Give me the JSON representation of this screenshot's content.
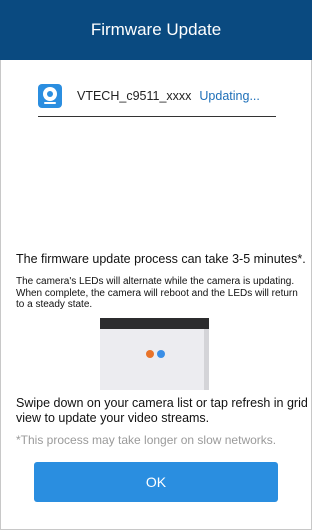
{
  "header": {
    "title": "Firmware Update"
  },
  "device": {
    "icon": "camera-icon",
    "name": "VTECH_c9511_xxxx",
    "status": "Updating..."
  },
  "info": {
    "main": "The firmware update process can take 3-5 minutes*.",
    "detail": "The camera's LEDs will alternate while the camera is updating. When complete, the camera will reboot and the LEDs will return to a steady state."
  },
  "illustration": {
    "led_colors": [
      "#e8732a",
      "#3a8ee6"
    ]
  },
  "swipe_text": "Swipe down on your camera list or tap refresh in grid view to update your video streams.",
  "note": "*This process may take longer on slow networks.",
  "ok_button": {
    "label": "OK"
  },
  "colors": {
    "header_bg": "#0a4a80",
    "accent": "#2a8ee0",
    "status_text": "#1d6fb8"
  }
}
